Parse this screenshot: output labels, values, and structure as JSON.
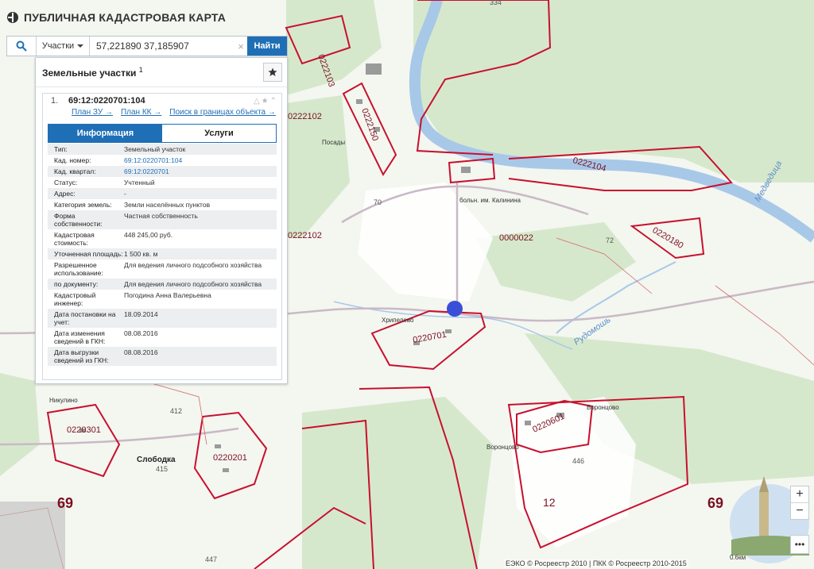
{
  "header": {
    "title": "ПУБЛИЧНАЯ КАДАСТРОВАЯ КАРТА",
    "logo_icon": "pkk-logo"
  },
  "search": {
    "type_label": "Участки",
    "value": "57,221890 37,185907",
    "clear_icon": "×",
    "find_label": "Найти"
  },
  "panel": {
    "title": "Земельные участки",
    "count": "1",
    "result": {
      "index": "1.",
      "kad_number": "69:12:0220701:104",
      "links": [
        "План ЗУ →",
        "План КК →",
        "Поиск в границах объекта →"
      ],
      "tabs": [
        "Информация",
        "Услуги"
      ],
      "attributes": [
        {
          "key": "Тип:",
          "value": "Земельный участок"
        },
        {
          "key": "Кад. номер:",
          "value": "69:12:0220701:104"
        },
        {
          "key": "Кад. квартал:",
          "value": "69:12:0220701"
        },
        {
          "key": "Статус:",
          "value": "Учтенный"
        },
        {
          "key": "Адрес:",
          "value": "-"
        },
        {
          "key": "Категория земель:",
          "value": "Земли населённых пунктов"
        },
        {
          "key": "Форма собственности:",
          "value": "Частная собственность"
        },
        {
          "key": "Кадастровая стоимость:",
          "value": "448 245,00 руб."
        },
        {
          "key": "Уточненная площадь:",
          "value": "1 500 кв. м"
        },
        {
          "key": "Разрешенное использование:",
          "value": "Для ведения личного подсобного хозяйства"
        },
        {
          "key": "по документу:",
          "value": "Для ведения личного подсобного хозяйства"
        },
        {
          "key": "Кадастровый инженер:",
          "value": "Погодина Анна Валерьевна"
        },
        {
          "key": "Дата постановки на учет:",
          "value": "18.09.2014"
        },
        {
          "key": "Дата изменения сведений в ГКН:",
          "value": "08.08.2016"
        },
        {
          "key": "Дата выгрузки сведений из ГКН:",
          "value": "08.08.2016"
        }
      ]
    }
  },
  "map": {
    "labels": {
      "q0222103": "0222103",
      "q0222102a": "0222102",
      "q0222102b": "0222102",
      "q0222150": "0222150",
      "q0222104": "0222104",
      "q0000022": "0000022",
      "q0220180": "0220180",
      "q0220701": "0220701",
      "q0220601": "0220601",
      "q0220301": "0220301",
      "q0220201": "0220201",
      "n70": "70",
      "n72": "72",
      "n412": "412",
      "n415": "415",
      "n446": "446",
      "n447": "447",
      "n334": "334",
      "n12": "12",
      "r69a": "69",
      "r69b": "69",
      "posady": "Посады",
      "boln": "больн. им. Калинина",
      "khripelevo": "Хрипелево",
      "nikulino": "Никулино",
      "sloboda": "Слободка",
      "vorontsovo1": "Воронцово",
      "vorontsovo2": "Воронцово",
      "medveditsa": "Медведица",
      "rudomosh": "Рудомошь"
    }
  },
  "controls": {
    "zoom_in": "+",
    "zoom_out": "−",
    "more": "•••"
  },
  "footer": {
    "copyright": "ЕЭКО © Росреестр 2010 | ПКК © Росреестр 2010-2015",
    "scale": "0.6км"
  },
  "colors": {
    "accent": "#1f6fb6",
    "boundary": "#c8102e",
    "marker": "#3a4fd8",
    "water": "#a8c8e8"
  }
}
